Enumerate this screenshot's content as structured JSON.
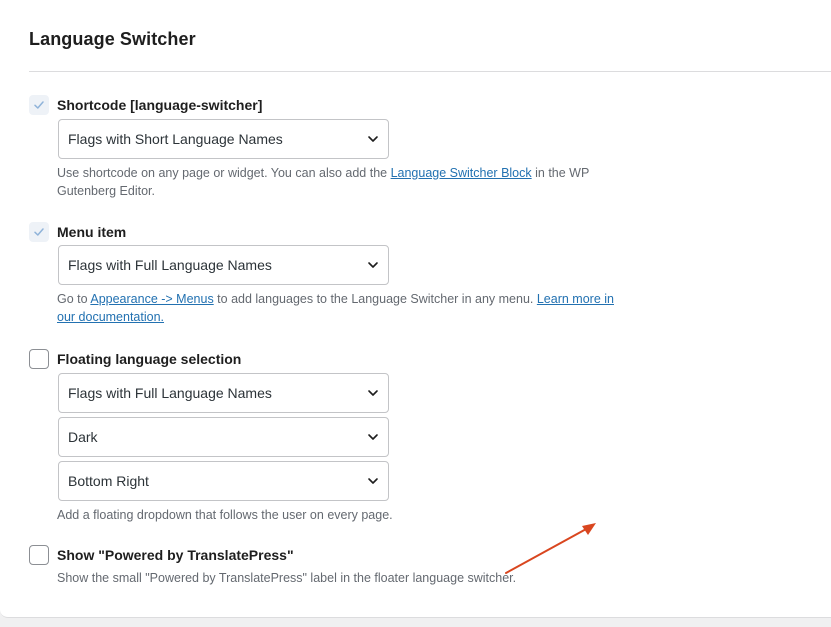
{
  "title": "Language Switcher",
  "shortcode": {
    "label": "Shortcode [language-switcher]",
    "checked": true,
    "select_value": "Flags with Short Language Names",
    "help_prefix": "Use shortcode on any page or widget. You can also add the ",
    "help_link": "Language Switcher Block",
    "help_suffix": " in the WP Gutenberg Editor."
  },
  "menu_item": {
    "label": "Menu item",
    "checked": true,
    "select_value": "Flags with Full Language Names",
    "help_prefix": "Go to ",
    "help_link1": "Appearance -> Menus",
    "help_middle": " to add languages to the Language Switcher in any menu. ",
    "help_link2": "Learn more in our documentation."
  },
  "floating": {
    "label": "Floating language selection",
    "checked": false,
    "select_names_value": "Flags with Full Language Names",
    "select_theme_value": "Dark",
    "select_position_value": "Bottom Right",
    "help": "Add a floating dropdown that follows the user on every page."
  },
  "powered_by": {
    "label": "Show \"Powered by TranslatePress\"",
    "checked": false,
    "help": "Show the small \"Powered by TranslatePress\" label in the floater language switcher."
  },
  "colors": {
    "link": "#2271b1",
    "annotation_arrow": "#d9461f",
    "checkmark": "#8fb3d9"
  },
  "icons": {
    "check": "check-icon",
    "chevron": "chevron-down-icon",
    "arrow": "annotation-arrow-icon"
  }
}
